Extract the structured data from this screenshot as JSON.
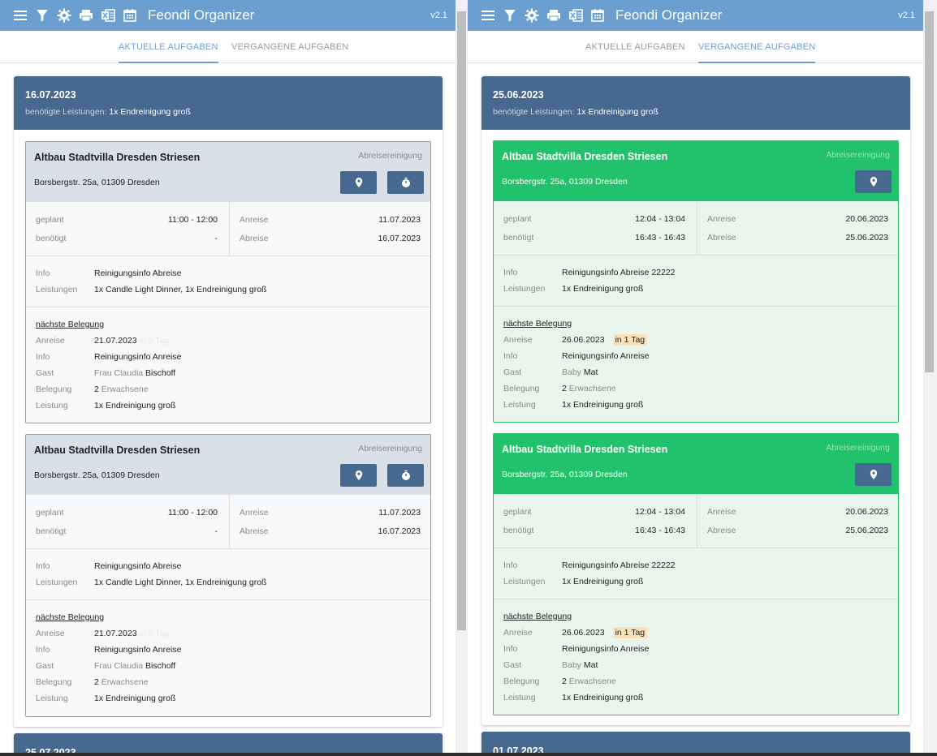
{
  "app": {
    "title": "Feondi Organizer",
    "version": "v2.1"
  },
  "toolbar_icons": [
    "menu-icon",
    "filter-icon",
    "gear-icon",
    "print-icon",
    "excel-export-icon",
    "calendar-icon"
  ],
  "tabs": {
    "current": "AKTUELLE AUFGABEN",
    "past": "VERGANGENE AUFGABEN"
  },
  "labels": {
    "needs": "benötigte Leistungen:",
    "planned": "geplant",
    "needed": "benötigt",
    "arrival": "Anreise",
    "departure": "Abreise",
    "info": "Info",
    "services": "Leistungen",
    "next_booking": "nächste Belegung",
    "guest": "Gast",
    "occupancy": "Belegung",
    "service": "Leistung"
  },
  "left": {
    "active_tab": "current",
    "day": {
      "date": "16.07.2023",
      "needs": "1x Endreinigung groß"
    },
    "cards": [
      {
        "title": "Altbau Stadtvilla Dresden Striesen",
        "type": "Abreisereinigung",
        "address": "Borsbergstr. 25a, 01309 Dresden",
        "planned": "11:00 - 12:00",
        "needed": "-",
        "arrival": "11.07.2023",
        "departure": "16.07.2023",
        "info": "Reinigungsinfo Abreise",
        "services": "1x Candle Light Dinner, 1x Endreinigung groß",
        "next": {
          "arrival": "21.07.2023",
          "badge": "in 5 Tag",
          "info": "Reinigungsinfo Anreise",
          "guest_first": "Frau Claudia",
          "guest_last": "Bischoff",
          "occupancy_num": "2",
          "occupancy_text": "Erwachsene",
          "service": "1x Endreinigung groß"
        }
      },
      {
        "title": "Altbau Stadtvilla Dresden Striesen",
        "type": "Abreisereinigung",
        "address": "Borsbergstr. 25a, 01309 Dresden",
        "planned": "11:00 - 12:00",
        "needed": "-",
        "arrival": "11.07.2023",
        "departure": "16.07.2023",
        "info": "Reinigungsinfo Abreise",
        "services": "1x Candle Light Dinner, 1x Endreinigung groß",
        "next": {
          "arrival": "21.07.2023",
          "badge": "in 5 Tag",
          "info": "Reinigungsinfo Anreise",
          "guest_first": "Frau Claudia",
          "guest_last": "Bischoff",
          "occupancy_num": "2",
          "occupancy_text": "Erwachsene",
          "service": "1x Endreinigung groß"
        }
      }
    ],
    "next_day": "25.07.2023"
  },
  "right": {
    "active_tab": "past",
    "day": {
      "date": "25.06.2023",
      "needs": "1x Endreinigung groß"
    },
    "cards": [
      {
        "title": "Altbau Stadtvilla Dresden Striesen",
        "type": "Abreisereinigung",
        "address": "Borsbergstr. 25a, 01309 Dresden",
        "planned": "12:04 - 13:04",
        "needed": "16:43 - 16:43",
        "arrival": "20.06.2023",
        "departure": "25.06.2023",
        "info": "Reinigungsinfo Abreise 22222",
        "services": "1x Endreinigung groß",
        "next": {
          "arrival": "26.06.2023",
          "badge": "in 1 Tag",
          "info": "Reinigungsinfo Anreise",
          "guest_first": "Baby",
          "guest_last": "Mat",
          "occupancy_num": "2",
          "occupancy_text": "Erwachsene",
          "service": "1x Endreinigung groß"
        }
      },
      {
        "title": "Altbau Stadtvilla Dresden Striesen",
        "type": "Abreisereinigung",
        "address": "Borsbergstr. 25a, 01309 Dresden",
        "planned": "12:04 - 13:04",
        "needed": "16:43 - 16:43",
        "arrival": "20.06.2023",
        "departure": "25.06.2023",
        "info": "Reinigungsinfo Abreise 22222",
        "services": "1x Endreinigung groß",
        "next": {
          "arrival": "26.06.2023",
          "badge": "in 1 Tag",
          "info": "Reinigungsinfo Anreise",
          "guest_first": "Baby",
          "guest_last": "Mat",
          "occupancy_num": "2",
          "occupancy_text": "Erwachsene",
          "service": "1x Endreinigung groß"
        }
      }
    ],
    "next_day": "01.07.2023"
  },
  "colors": {
    "appbar": "#6a9fd0",
    "day_header": "#48698f",
    "done_card": "#22c16b",
    "badge": "#fde2b8"
  }
}
